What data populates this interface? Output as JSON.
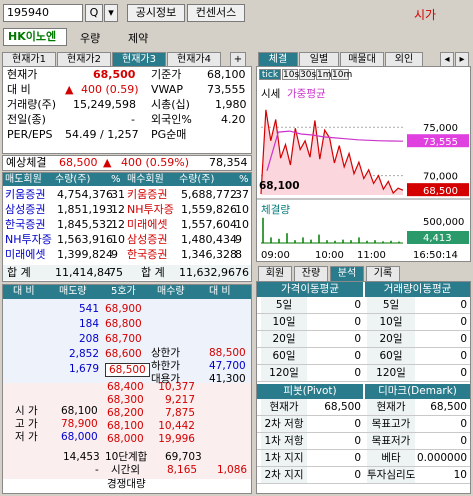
{
  "top": {
    "code": "195940",
    "btn_search": "Q",
    "btn_public": "공시정보",
    "btn_consensus": "컨센서스",
    "sise_link": "시가",
    "name": "HK이노엔",
    "tag1": "우량",
    "tag2": "제약"
  },
  "left_tabs": [
    "현재가1",
    "현재가2",
    "현재가3",
    "현재가4",
    "+"
  ],
  "info": {
    "cur_label": "현재가",
    "cur_value": "68,500",
    "base_label": "기준가",
    "base_value": "68,100",
    "diff_label": "대 비",
    "diff_value": "400 (0.59)",
    "vwap_label": "VWAP",
    "vwap_value": "73,555",
    "vol_label": "거래량(주)",
    "vol_value": "15,249,598",
    "cap_label": "시총(십)",
    "cap_value": "1,980",
    "prev_label": "전일(종)",
    "prev_value": "-",
    "foreign_label": "외국인%",
    "foreign_value": "4.20",
    "per_label": "PER/EPS",
    "per_value": "54.49 / 1,257",
    "pg_label": "PG순매",
    "pg_value": ""
  },
  "expect": {
    "label": "예상체결",
    "price": "68,500",
    "change": "400 (0.59%)",
    "volume": "78,354"
  },
  "broker": {
    "headers": [
      "매도회원",
      "수량(주)",
      "%",
      "매수회원",
      "수량(주)",
      "%"
    ],
    "rows": [
      [
        "키움증권",
        "4,754,376",
        "31",
        "키움증권",
        "5,688,772",
        "37"
      ],
      [
        "삼성증권",
        "1,851,193",
        "12",
        "NH투자증",
        "1,559,826",
        "10"
      ],
      [
        "한국증권",
        "1,845,532",
        "12",
        "미래에셋",
        "1,557,604",
        "10"
      ],
      [
        "NH투자증",
        "1,563,916",
        "10",
        "삼성증권",
        "1,480,434",
        "9"
      ],
      [
        "미래에셋",
        "1,399,824",
        "9",
        "한국증권",
        "1,346,328",
        "8"
      ]
    ],
    "total_label": "합 계",
    "total_sell": "11,414,84",
    "total_sell_pct": "75",
    "total_buy": "11,632,96",
    "total_buy_pct": "76"
  },
  "orderbook": {
    "headers": [
      "대 비",
      "매도량",
      "5호가",
      "매수량",
      "대 비"
    ],
    "asks": [
      [
        "541",
        "68,900"
      ],
      [
        "184",
        "68,800"
      ],
      [
        "208",
        "68,700"
      ],
      [
        "2,852",
        "68,600"
      ],
      [
        "1,679",
        "68,500"
      ]
    ],
    "bids": [
      [
        "68,400",
        "10,377"
      ],
      [
        "68,300",
        "9,217"
      ],
      [
        "68,200",
        "7,875"
      ],
      [
        "68,100",
        "10,442"
      ],
      [
        "68,000",
        "19,996"
      ]
    ],
    "limits": {
      "upper_label": "상한가",
      "upper_value": "88,500",
      "lower_label": "하한가",
      "lower_value": "47,700",
      "vi_label": "대용가",
      "vi_value": "41,300"
    },
    "ohl": {
      "open_label": "시 가",
      "open_value": "68,100",
      "high_label": "고 가",
      "high_value": "78,900",
      "low_label": "저 가",
      "low_value": "68,000"
    },
    "total_ask": "14,453",
    "total_label": "10단계합",
    "total_bid": "69,703",
    "after_minus": "-",
    "after_label": "시간외",
    "after_price": "8,165",
    "after_qty": "1,086",
    "footer": "경쟁대량"
  },
  "right_tabs": [
    "체결",
    "일별",
    "매물대",
    "외인"
  ],
  "chart": {
    "chips": [
      "tick",
      "10s",
      "30s",
      "1m",
      "10m"
    ],
    "legend_a": "시세",
    "legend_b": "가중평균",
    "price_tick_high": "75,000",
    "price_tick_low": "70,000",
    "vwap_tag": "73,555",
    "close_tag": "68,500",
    "low_label": "68,100",
    "vol_title": "체결량",
    "vol_tick": "500,000",
    "vol_tag": "4,413",
    "times": [
      "09:00",
      "10:00",
      "11:00",
      "16:50:14"
    ]
  },
  "chart_data": {
    "type": "line",
    "series": [
      {
        "name": "시세",
        "values": [
          68100,
          76800,
          73600,
          75800,
          71800,
          73200,
          71100,
          74900,
          72700,
          73600,
          71900,
          75700,
          71700,
          74700,
          73900,
          71300,
          73100,
          70900,
          72300,
          70200,
          71400,
          69700,
          70600,
          69200,
          70000,
          68600,
          69400,
          68200,
          68700,
          68500
        ]
      },
      {
        "name": "가중평균",
        "values": [
          70500,
          74500,
          74600,
          74300,
          74200,
          74000,
          73900,
          73800,
          73700,
          73650,
          73600,
          73580,
          73555
        ]
      }
    ],
    "ylim": [
      68000,
      77500
    ]
  },
  "bottom_tabs": [
    "회원",
    "잔량",
    "분석",
    "기록"
  ],
  "stats": {
    "h1": "가격이동평균",
    "h2": "거래량이동평균",
    "rows": [
      [
        "5일",
        "0",
        "5일",
        "0"
      ],
      [
        "10일",
        "0",
        "10일",
        "0"
      ],
      [
        "20일",
        "0",
        "20일",
        "0"
      ],
      [
        "60일",
        "0",
        "60일",
        "0"
      ],
      [
        "120일",
        "0",
        "120일",
        "0"
      ]
    ],
    "h3": "피봇(Pivot)",
    "h4": "디마크(Demark)",
    "rows2": [
      [
        "현재가",
        "68,500",
        "현재가",
        "68,500"
      ],
      [
        "2차 저항",
        "0",
        "목표고가",
        "0"
      ],
      [
        "1차 저항",
        "0",
        "목표저가",
        "0"
      ],
      [
        "1차 지지",
        "0",
        "베타",
        "0.000000"
      ],
      [
        "2차 지지",
        "0",
        "투자심리도",
        "10"
      ]
    ]
  }
}
